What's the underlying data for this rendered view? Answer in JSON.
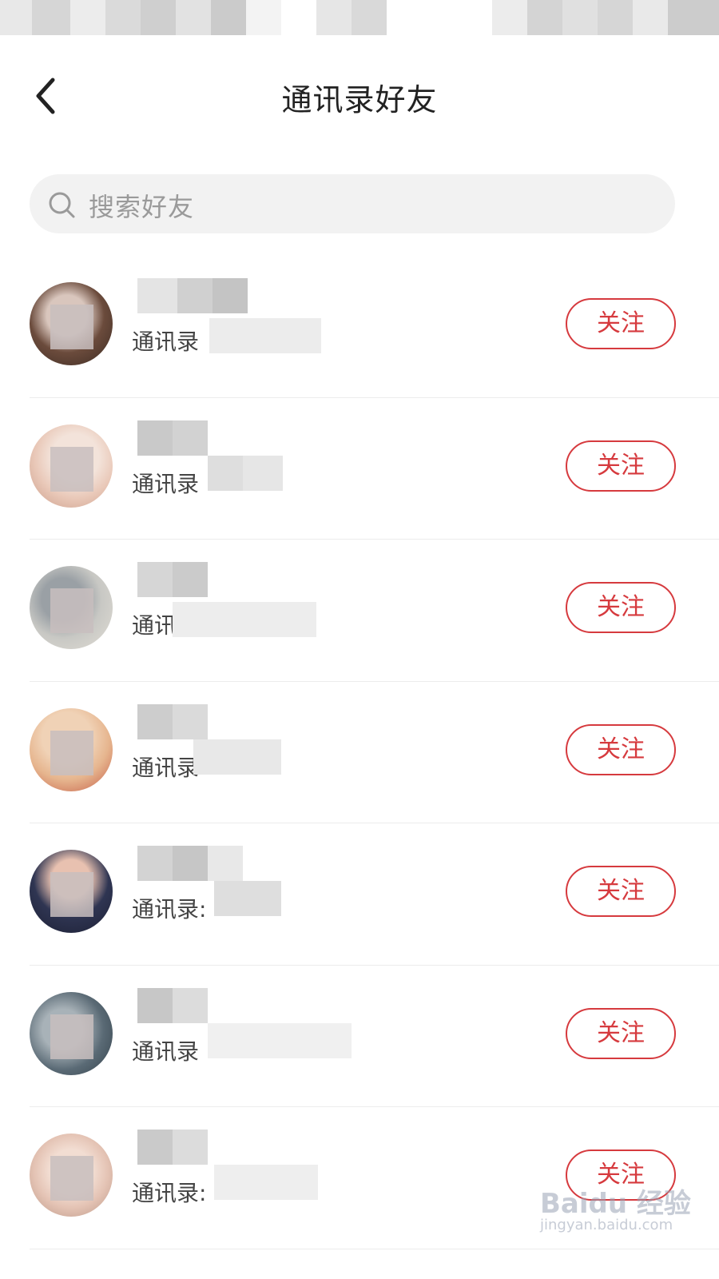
{
  "header": {
    "title": "通讯录好友"
  },
  "search": {
    "placeholder": "搜索好友"
  },
  "contacts": [
    {
      "name": "",
      "sub": "通讯录",
      "follow_label": "关注"
    },
    {
      "name": "",
      "sub": "通讯录",
      "follow_label": "关注"
    },
    {
      "name": "",
      "sub": "通讯录",
      "follow_label": "关注"
    },
    {
      "name": "",
      "sub": "通讯录",
      "follow_label": "关注"
    },
    {
      "name": "",
      "sub": "通讯录:",
      "follow_label": "关注"
    },
    {
      "name": "",
      "sub": "通讯录",
      "follow_label": "关注"
    },
    {
      "name": "",
      "sub": "通讯录:",
      "follow_label": "关注"
    }
  ],
  "watermark": {
    "brand": "Baidu 经验",
    "url": "jingyan.baidu.com"
  },
  "colors": {
    "accent": "#d63a3e",
    "search_bg": "#f2f2f2",
    "placeholder": "#9a9a9a",
    "divider": "#ececec"
  },
  "icons": {
    "back": "chevron-left-icon",
    "search": "search-icon"
  }
}
